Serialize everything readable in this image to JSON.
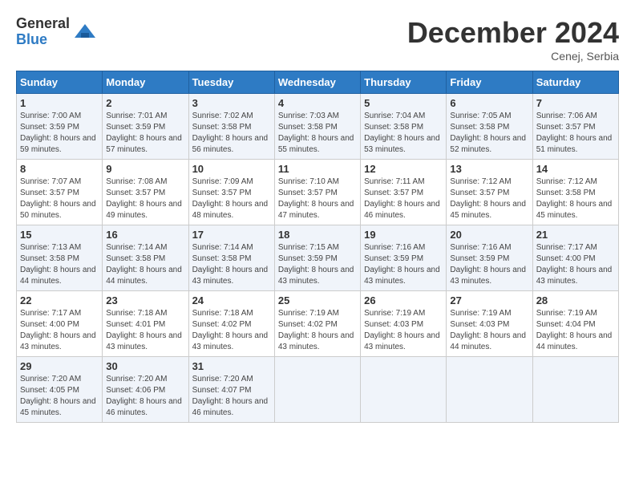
{
  "logo": {
    "general": "General",
    "blue": "Blue"
  },
  "title": "December 2024",
  "location": "Cenej, Serbia",
  "weekdays": [
    "Sunday",
    "Monday",
    "Tuesday",
    "Wednesday",
    "Thursday",
    "Friday",
    "Saturday"
  ],
  "weeks": [
    [
      {
        "day": "1",
        "sunrise": "Sunrise: 7:00 AM",
        "sunset": "Sunset: 3:59 PM",
        "daylight": "Daylight: 8 hours and 59 minutes."
      },
      {
        "day": "2",
        "sunrise": "Sunrise: 7:01 AM",
        "sunset": "Sunset: 3:59 PM",
        "daylight": "Daylight: 8 hours and 57 minutes."
      },
      {
        "day": "3",
        "sunrise": "Sunrise: 7:02 AM",
        "sunset": "Sunset: 3:58 PM",
        "daylight": "Daylight: 8 hours and 56 minutes."
      },
      {
        "day": "4",
        "sunrise": "Sunrise: 7:03 AM",
        "sunset": "Sunset: 3:58 PM",
        "daylight": "Daylight: 8 hours and 55 minutes."
      },
      {
        "day": "5",
        "sunrise": "Sunrise: 7:04 AM",
        "sunset": "Sunset: 3:58 PM",
        "daylight": "Daylight: 8 hours and 53 minutes."
      },
      {
        "day": "6",
        "sunrise": "Sunrise: 7:05 AM",
        "sunset": "Sunset: 3:58 PM",
        "daylight": "Daylight: 8 hours and 52 minutes."
      },
      {
        "day": "7",
        "sunrise": "Sunrise: 7:06 AM",
        "sunset": "Sunset: 3:57 PM",
        "daylight": "Daylight: 8 hours and 51 minutes."
      }
    ],
    [
      {
        "day": "8",
        "sunrise": "Sunrise: 7:07 AM",
        "sunset": "Sunset: 3:57 PM",
        "daylight": "Daylight: 8 hours and 50 minutes."
      },
      {
        "day": "9",
        "sunrise": "Sunrise: 7:08 AM",
        "sunset": "Sunset: 3:57 PM",
        "daylight": "Daylight: 8 hours and 49 minutes."
      },
      {
        "day": "10",
        "sunrise": "Sunrise: 7:09 AM",
        "sunset": "Sunset: 3:57 PM",
        "daylight": "Daylight: 8 hours and 48 minutes."
      },
      {
        "day": "11",
        "sunrise": "Sunrise: 7:10 AM",
        "sunset": "Sunset: 3:57 PM",
        "daylight": "Daylight: 8 hours and 47 minutes."
      },
      {
        "day": "12",
        "sunrise": "Sunrise: 7:11 AM",
        "sunset": "Sunset: 3:57 PM",
        "daylight": "Daylight: 8 hours and 46 minutes."
      },
      {
        "day": "13",
        "sunrise": "Sunrise: 7:12 AM",
        "sunset": "Sunset: 3:57 PM",
        "daylight": "Daylight: 8 hours and 45 minutes."
      },
      {
        "day": "14",
        "sunrise": "Sunrise: 7:12 AM",
        "sunset": "Sunset: 3:58 PM",
        "daylight": "Daylight: 8 hours and 45 minutes."
      }
    ],
    [
      {
        "day": "15",
        "sunrise": "Sunrise: 7:13 AM",
        "sunset": "Sunset: 3:58 PM",
        "daylight": "Daylight: 8 hours and 44 minutes."
      },
      {
        "day": "16",
        "sunrise": "Sunrise: 7:14 AM",
        "sunset": "Sunset: 3:58 PM",
        "daylight": "Daylight: 8 hours and 44 minutes."
      },
      {
        "day": "17",
        "sunrise": "Sunrise: 7:14 AM",
        "sunset": "Sunset: 3:58 PM",
        "daylight": "Daylight: 8 hours and 43 minutes."
      },
      {
        "day": "18",
        "sunrise": "Sunrise: 7:15 AM",
        "sunset": "Sunset: 3:59 PM",
        "daylight": "Daylight: 8 hours and 43 minutes."
      },
      {
        "day": "19",
        "sunrise": "Sunrise: 7:16 AM",
        "sunset": "Sunset: 3:59 PM",
        "daylight": "Daylight: 8 hours and 43 minutes."
      },
      {
        "day": "20",
        "sunrise": "Sunrise: 7:16 AM",
        "sunset": "Sunset: 3:59 PM",
        "daylight": "Daylight: 8 hours and 43 minutes."
      },
      {
        "day": "21",
        "sunrise": "Sunrise: 7:17 AM",
        "sunset": "Sunset: 4:00 PM",
        "daylight": "Daylight: 8 hours and 43 minutes."
      }
    ],
    [
      {
        "day": "22",
        "sunrise": "Sunrise: 7:17 AM",
        "sunset": "Sunset: 4:00 PM",
        "daylight": "Daylight: 8 hours and 43 minutes."
      },
      {
        "day": "23",
        "sunrise": "Sunrise: 7:18 AM",
        "sunset": "Sunset: 4:01 PM",
        "daylight": "Daylight: 8 hours and 43 minutes."
      },
      {
        "day": "24",
        "sunrise": "Sunrise: 7:18 AM",
        "sunset": "Sunset: 4:02 PM",
        "daylight": "Daylight: 8 hours and 43 minutes."
      },
      {
        "day": "25",
        "sunrise": "Sunrise: 7:19 AM",
        "sunset": "Sunset: 4:02 PM",
        "daylight": "Daylight: 8 hours and 43 minutes."
      },
      {
        "day": "26",
        "sunrise": "Sunrise: 7:19 AM",
        "sunset": "Sunset: 4:03 PM",
        "daylight": "Daylight: 8 hours and 43 minutes."
      },
      {
        "day": "27",
        "sunrise": "Sunrise: 7:19 AM",
        "sunset": "Sunset: 4:03 PM",
        "daylight": "Daylight: 8 hours and 44 minutes."
      },
      {
        "day": "28",
        "sunrise": "Sunrise: 7:19 AM",
        "sunset": "Sunset: 4:04 PM",
        "daylight": "Daylight: 8 hours and 44 minutes."
      }
    ],
    [
      {
        "day": "29",
        "sunrise": "Sunrise: 7:20 AM",
        "sunset": "Sunset: 4:05 PM",
        "daylight": "Daylight: 8 hours and 45 minutes."
      },
      {
        "day": "30",
        "sunrise": "Sunrise: 7:20 AM",
        "sunset": "Sunset: 4:06 PM",
        "daylight": "Daylight: 8 hours and 46 minutes."
      },
      {
        "day": "31",
        "sunrise": "Sunrise: 7:20 AM",
        "sunset": "Sunset: 4:07 PM",
        "daylight": "Daylight: 8 hours and 46 minutes."
      },
      null,
      null,
      null,
      null
    ]
  ]
}
